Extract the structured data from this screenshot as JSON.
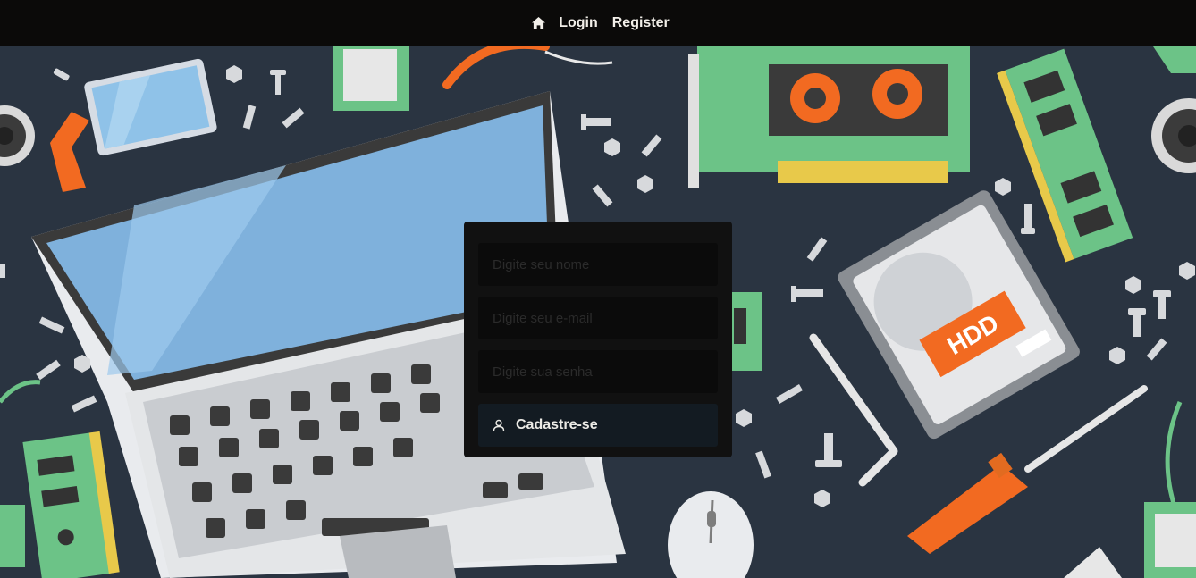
{
  "nav": {
    "home_icon": "home-icon",
    "login_label": "Login",
    "register_label": "Register"
  },
  "form": {
    "name_placeholder": "Digite seu nome",
    "email_placeholder": "Digite seu e-mail",
    "password_placeholder": "Digite sua senha",
    "submit_label": "Cadastre-se",
    "submit_icon": "user-icon"
  },
  "background": {
    "hdd_label": "HDD"
  },
  "colors": {
    "navbar": "#0b0a09",
    "background": "#2a3441",
    "card": "#111111",
    "button": "#131b22",
    "accent_orange": "#f26a21",
    "pcb_green": "#6cc387"
  }
}
